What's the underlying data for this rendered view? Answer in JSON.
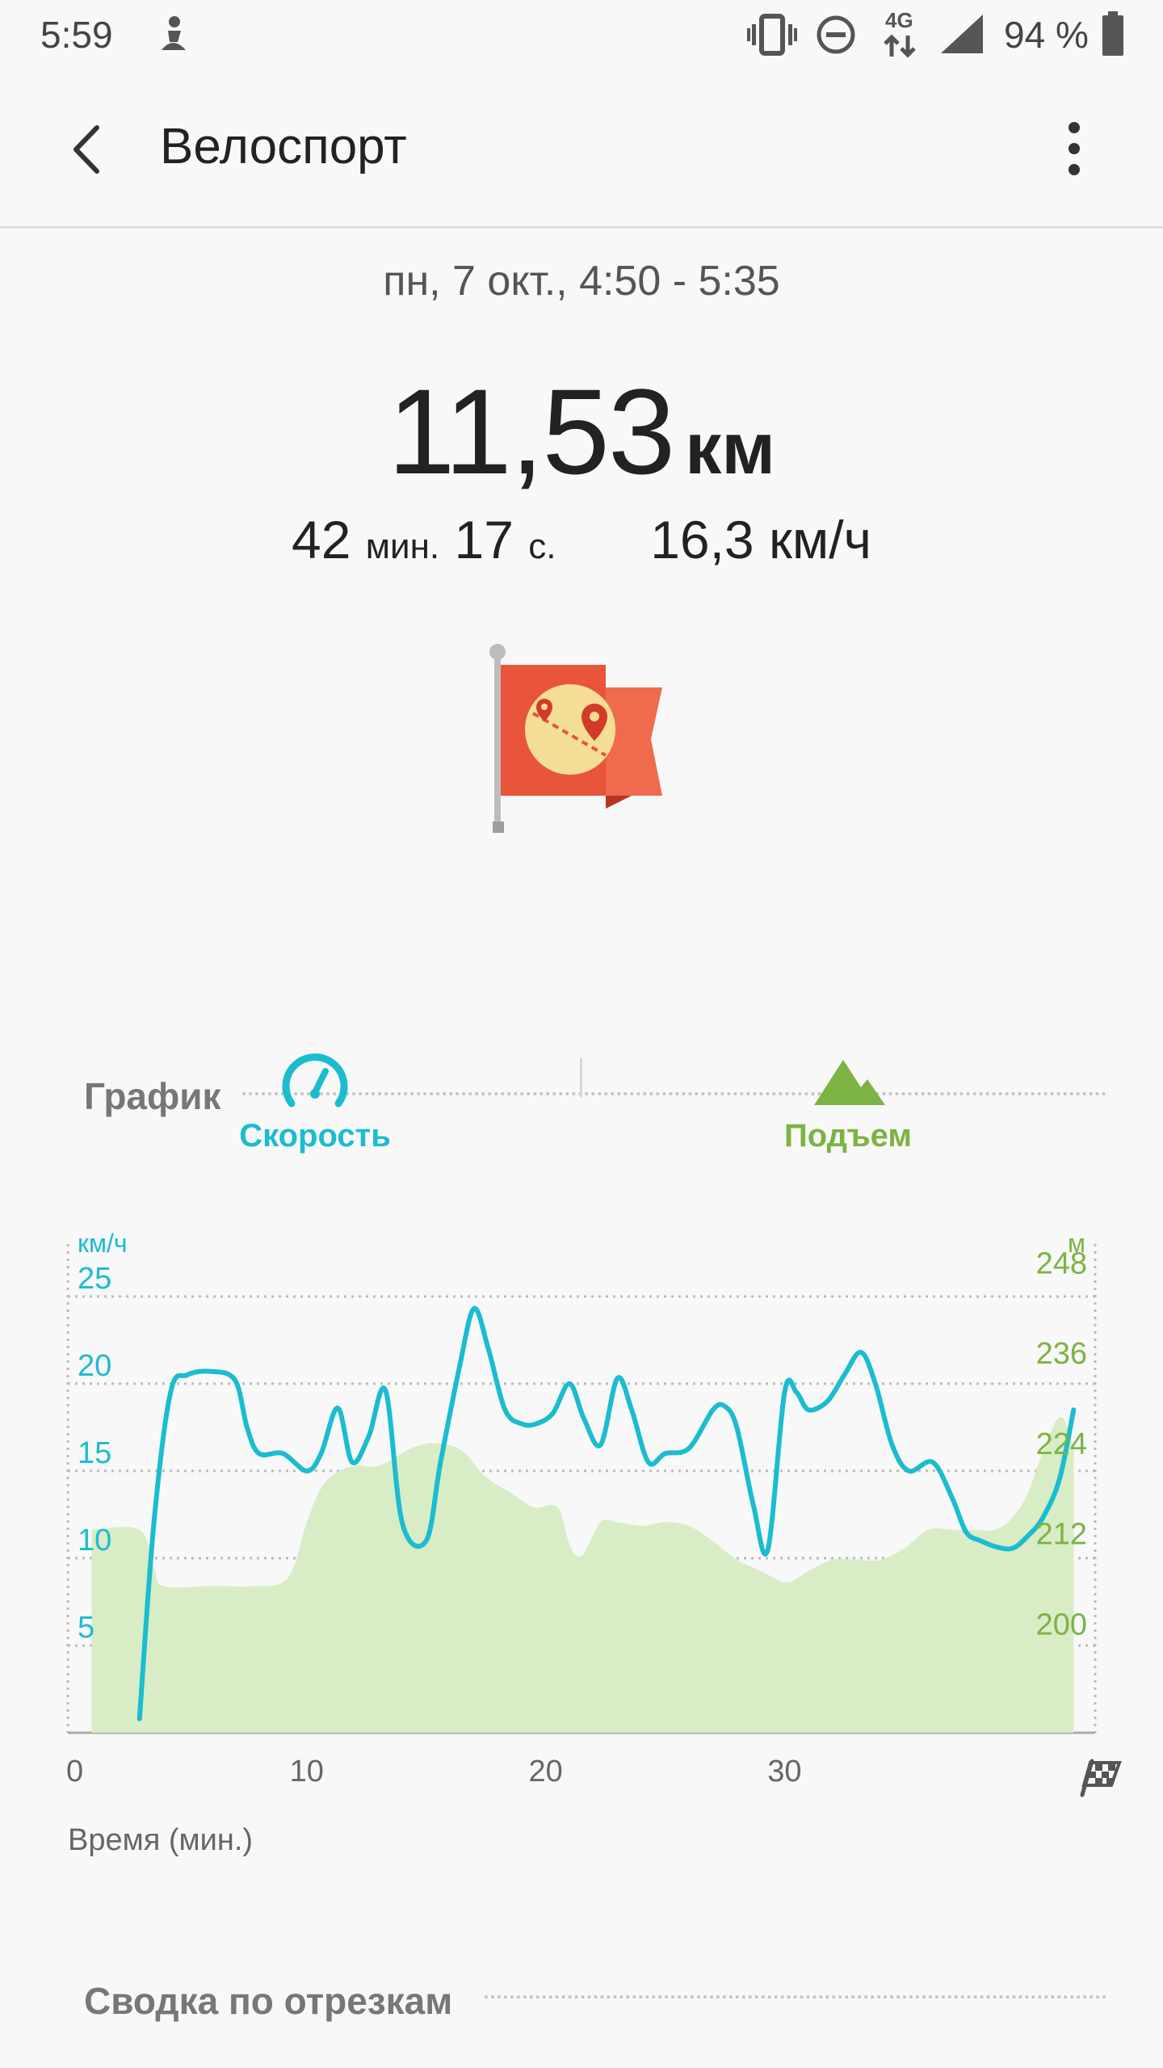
{
  "status_bar": {
    "time": "5:59",
    "network": "4G",
    "battery": "94 %",
    "icons": [
      "rider-icon",
      "vibrate-icon",
      "dnd-icon",
      "network-4g-icon",
      "signal-icon",
      "battery-icon"
    ]
  },
  "app_bar": {
    "title": "Велоспорт",
    "back_icon": "back-arrow-icon",
    "menu_icon": "more-vert-icon"
  },
  "workout": {
    "datetime": "пн, 7 окт., 4:50 - 5:35",
    "distance_value": "11,53",
    "distance_unit": "км",
    "duration_min": "42",
    "duration_min_unit": "мин.",
    "duration_sec": "17",
    "duration_sec_unit": "с.",
    "avg_speed": "16,3 км/ч",
    "badge_icon": "map-flag-icon"
  },
  "graph_section": {
    "title": "График",
    "tabs": [
      {
        "label": "Скорость",
        "icon": "speedometer-icon",
        "color": "#1bbcd0"
      },
      {
        "label": "Подъем",
        "icon": "mountain-icon",
        "color": "#7cb342"
      }
    ]
  },
  "colors": {
    "speed": "#1bbcd0",
    "elevation_line": "#7cb342",
    "elevation_fill": "#d8ecc6"
  },
  "chart_data": {
    "type": "line",
    "title": "",
    "xlabel": "Время (мин.)",
    "x_ticks": [
      "0",
      "10",
      "20",
      "30"
    ],
    "xlim": [
      0,
      43
    ],
    "left_axis": {
      "unit": "км/ч",
      "ticks": [
        "25",
        "20",
        "15",
        "10",
        "5"
      ],
      "ylim": [
        0,
        28
      ]
    },
    "right_axis": {
      "unit": "м",
      "ticks": [
        "248",
        "236",
        "224",
        "212",
        "200"
      ],
      "ylim": [
        188,
        253
      ]
    },
    "finish_icon": "checkered-flag-icon",
    "series": [
      {
        "axis": "left",
        "type": "line",
        "x": [
          3,
          3.6,
          4.3,
          5,
          6,
          7,
          7.5,
          8,
          9,
          10,
          10.6,
          11.3,
          11.9,
          12.6,
          13.3,
          14,
          15,
          15.6,
          16.4,
          17,
          17.6,
          18.3,
          19,
          19.6,
          20.3,
          21,
          21.6,
          22.3,
          23,
          23.6,
          24.3,
          25,
          26,
          27,
          27.5,
          28,
          28.7,
          29.3,
          30,
          30.5,
          31,
          31.8,
          32.5,
          33.2,
          33.8,
          34.5,
          35.2,
          36.2,
          37,
          37.6,
          38.2,
          39,
          39.6,
          40.2,
          40.8,
          41.5,
          42.1
        ],
        "y": [
          0.8,
          12,
          19.5,
          20.5,
          20.7,
          20.2,
          17.5,
          16,
          16,
          15,
          16,
          18.6,
          15.5,
          17,
          19.6,
          12,
          11,
          15.5,
          21,
          24.3,
          22,
          18.5,
          17.7,
          17.7,
          18.3,
          20,
          18,
          16.5,
          20.3,
          18.5,
          15.5,
          16,
          16.3,
          18.5,
          18.7,
          17.5,
          13,
          10.5,
          19.5,
          19.5,
          18.5,
          19,
          20.5,
          21.8,
          20,
          16.5,
          15,
          15.5,
          13.5,
          11.5,
          11,
          10.6,
          10.6,
          11.3,
          12.3,
          14.5,
          18.5
        ]
      },
      {
        "axis": "right",
        "type": "area",
        "x": [
          1,
          3,
          3.6,
          4,
          6,
          8,
          9,
          9.5,
          10,
          10.6,
          11.2,
          12,
          13,
          14.5,
          15.5,
          16.5,
          17.5,
          18.5,
          19.5,
          20.5,
          21,
          21.5,
          22.3,
          23,
          24,
          25,
          26,
          27,
          28,
          29,
          30,
          30.5,
          31,
          32,
          33,
          34,
          35,
          36,
          37,
          38,
          38.8,
          39.5,
          40.2,
          41,
          41.6,
          42.1
        ],
        "y": [
          215,
          215,
          210,
          207.5,
          207.5,
          207.5,
          208,
          210.5,
          216,
          220.5,
          222.5,
          223.5,
          223.5,
          226,
          226.5,
          225.5,
          222,
          220,
          218,
          218,
          213,
          211.5,
          216,
          216,
          215.5,
          216,
          215.5,
          213.5,
          211,
          209.5,
          208,
          208.5,
          209.5,
          211,
          211,
          211,
          212.5,
          215,
          215,
          215,
          215,
          216.5,
          220,
          227,
          230,
          226
        ]
      }
    ]
  },
  "segments_section": {
    "title": "Сводка по отрезкам"
  }
}
